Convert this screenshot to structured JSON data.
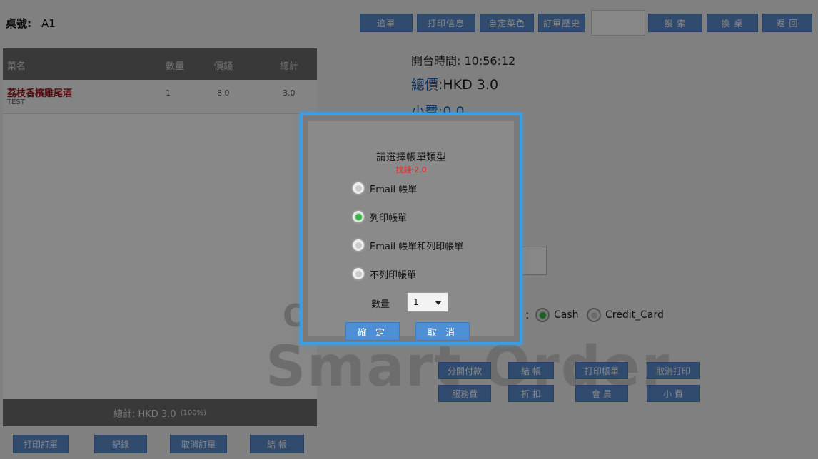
{
  "header": {
    "table_label": "桌號:",
    "table_value": "A1",
    "buttons": [
      "追單",
      "打印信息",
      "自定菜色",
      "訂單歷史"
    ],
    "search_value": "",
    "right_buttons": [
      "搜 索",
      "換 桌",
      "返 回"
    ]
  },
  "order_table": {
    "columns": [
      "菜名",
      "數量",
      "價錢",
      "總計"
    ],
    "rows": [
      {
        "name": "荔枝香檳雞尾酒",
        "note": "TEST",
        "qty": "1",
        "price": "8.0",
        "total": "3.0"
      }
    ],
    "total_text": "總計: HKD 3.0",
    "total_pct": "(100%)"
  },
  "bottom_buttons": [
    "打印訂單",
    "記錄",
    "取消訂單",
    "結 帳"
  ],
  "info": {
    "open_time": "開台時間: 10:56:12",
    "total_label": "總價",
    "total_value": ":HKD 3.0",
    "tip": "小費:0.0"
  },
  "payment": {
    "colon": ":",
    "options": [
      {
        "label": "Cash",
        "selected": true
      },
      {
        "label": "Credit_Card",
        "selected": false
      }
    ]
  },
  "action_buttons_row1": [
    "分開付款",
    "結 帳",
    "打印帳單",
    "取消打印"
  ],
  "action_buttons_row2": [
    "服務費",
    "折 扣",
    "會 員",
    "小 費"
  ],
  "watermark": {
    "top": "O",
    "big": "Smart Order"
  },
  "dialog": {
    "title": "請選擇帳單類型",
    "change": "找錢:2.0",
    "options": [
      {
        "label": "Email 帳單",
        "selected": false
      },
      {
        "label": "列印帳單",
        "selected": true
      },
      {
        "label": "Email 帳單和列印帳單",
        "selected": false
      },
      {
        "label": "不列印帳單",
        "selected": false
      }
    ],
    "qty_label": "數量",
    "qty_value": "1",
    "confirm": "確 定",
    "cancel": "取 消"
  },
  "colors": {
    "button_blue": "#5b8fd0",
    "dialog_border": "#3a9ee6",
    "radio_selected": "#3bb54a",
    "dish_name": "#a0151d",
    "change_red": "#ee2222"
  }
}
